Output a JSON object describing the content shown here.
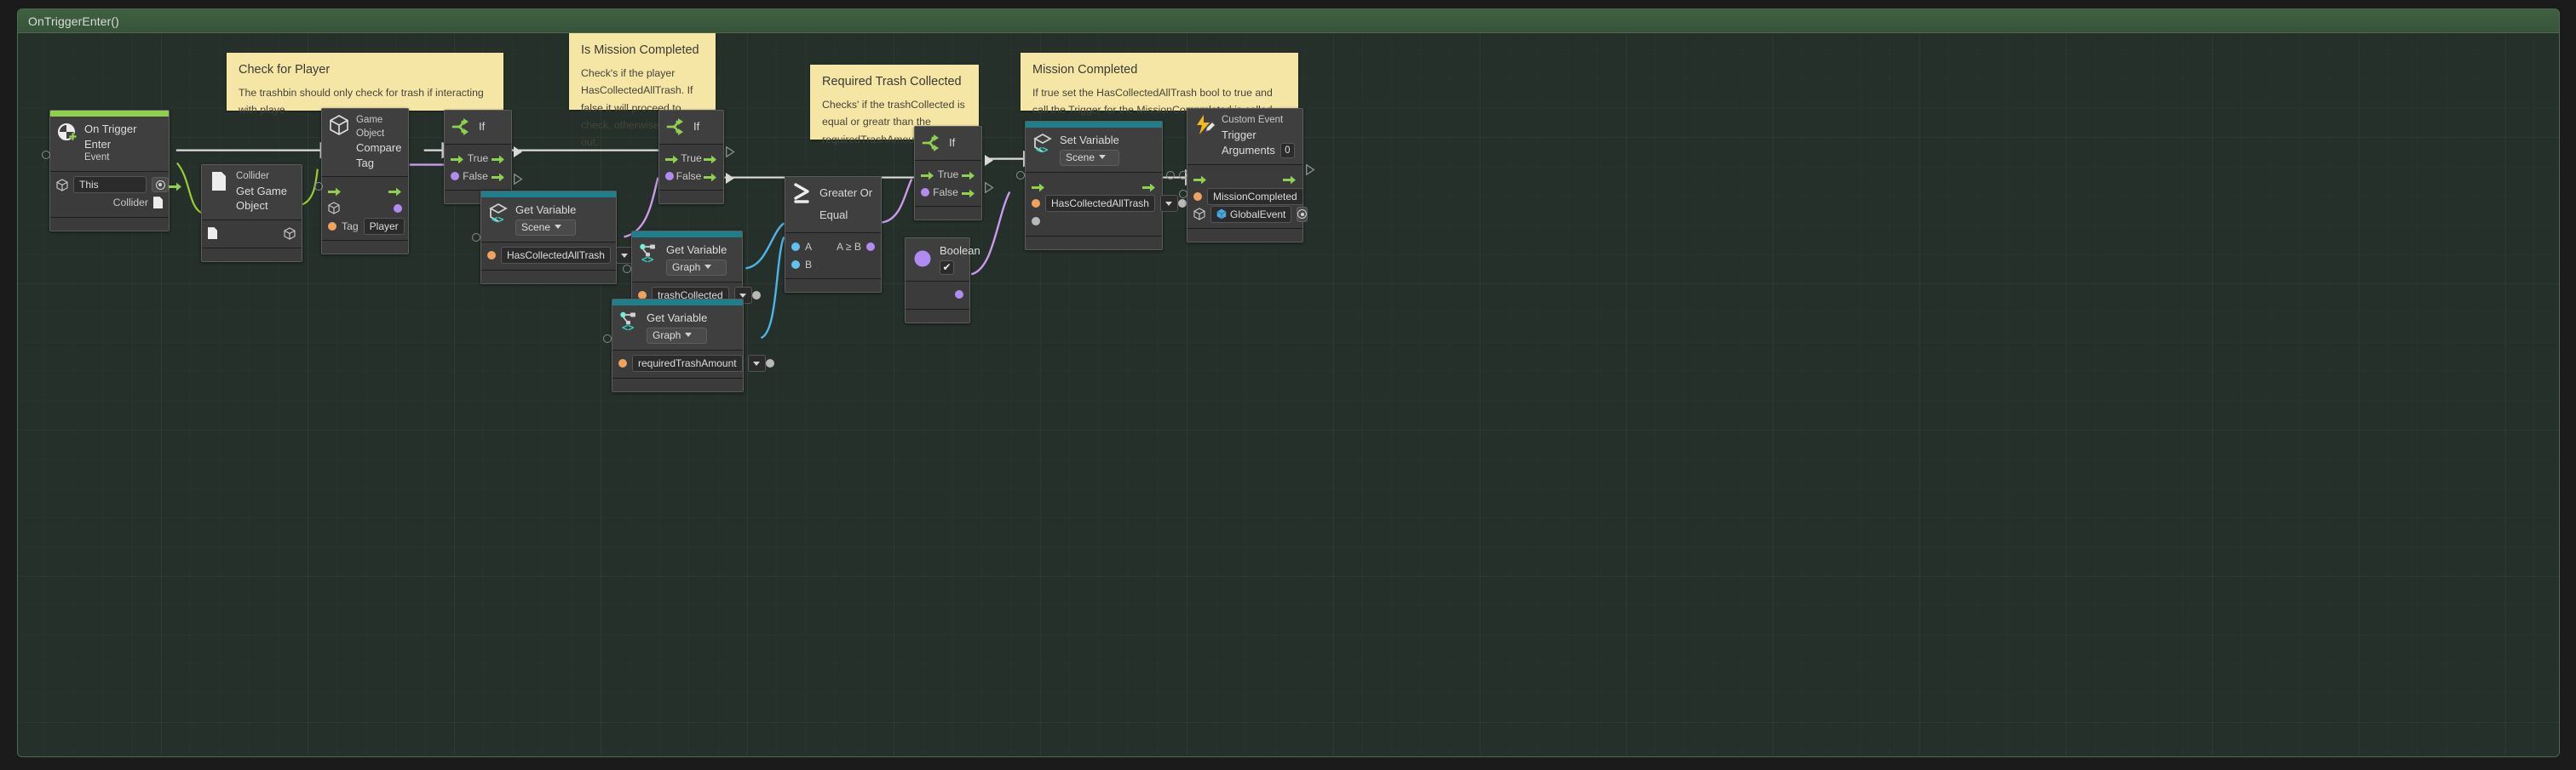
{
  "group": {
    "title": "OnTriggerEnter()"
  },
  "notes": [
    {
      "id": "check-for-player",
      "title": "Check for Player",
      "body": "The trashbin should only check for trash if interacting with playe."
    },
    {
      "id": "is-mission-completed",
      "title": "Is Mission Completed",
      "body": "Check's if the player HasCollectedAllTrash. If false it will proceed to check, otherwise it exits out."
    },
    {
      "id": "required-trash-collected",
      "title": "Required Trash Collected",
      "body": "Checks' if the trashCollected is  equal or greatr than the requiredTrashAmount"
    },
    {
      "id": "mission-completed",
      "title": "Mission Completed",
      "body": "If true set the HasCollectedAllTrash bool to true and call the Trigger for the MissionCompmleted is called."
    }
  ],
  "nodes": {
    "on_trigger_enter": {
      "title": "On Trigger Enter",
      "subtitle": "Event",
      "target_value": "This",
      "output_label": "Collider"
    },
    "get_game_object": {
      "title": "Collider",
      "subtitle": "Get Game Object"
    },
    "compare_tag": {
      "title": "Game Object",
      "subtitle": "Compare Tag",
      "tag_label": "Tag",
      "tag_value": "Player"
    },
    "if_1": {
      "title": "If",
      "true_label": "True",
      "false_label": "False"
    },
    "if_2": {
      "title": "If",
      "true_label": "True",
      "false_label": "False"
    },
    "if_3": {
      "title": "If",
      "true_label": "True",
      "false_label": "False"
    },
    "get_var_has_collected": {
      "title": "Get Variable",
      "scope": "Scene",
      "variable": "HasCollectedAllTrash"
    },
    "get_var_trash_collected": {
      "title": "Get Variable",
      "scope": "Graph",
      "variable": "trashCollected"
    },
    "get_var_required_amount": {
      "title": "Get Variable",
      "scope": "Graph",
      "variable": "requiredTrashAmount"
    },
    "greater_or_equal": {
      "title": "Greater Or Equal",
      "input_a": "A",
      "input_b": "B",
      "output": "A ≥ B"
    },
    "boolean": {
      "title": "Boolean",
      "value": "✔"
    },
    "set_variable": {
      "title": "Set Variable",
      "scope": "Scene",
      "variable": "HasCollectedAllTrash"
    },
    "custom_event": {
      "title": "Custom Event",
      "subtitle": "Trigger",
      "arguments_label": "Arguments",
      "arguments_value": "0",
      "event_name": "MissionCompleted",
      "target_value": "GlobalEvent"
    }
  },
  "colors": {
    "flow_green": "#8fd14f",
    "teal_header": "#1e7f8c",
    "bool_purple": "#b18cf0",
    "number_blue": "#5fc3ef",
    "string_orange": "#f0a35e",
    "note_yellow": "#f6e6a6",
    "group_green": "#3f6040"
  }
}
